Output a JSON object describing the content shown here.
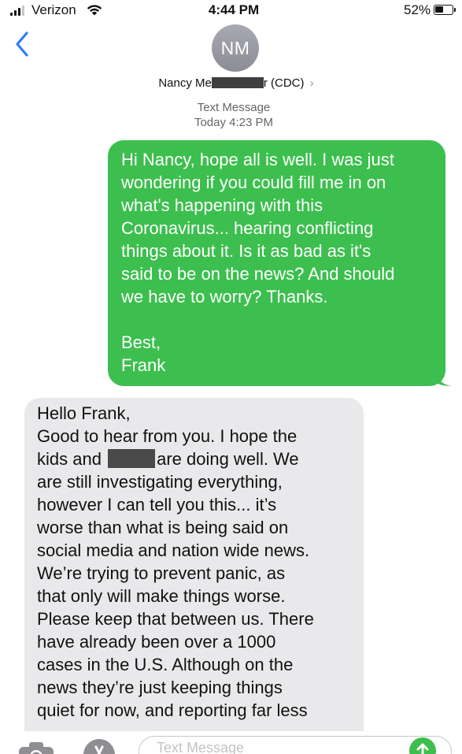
{
  "status_bar": {
    "carrier": "Verizon",
    "time": "4:44 PM",
    "battery_percent": "52%",
    "battery_level": 0.52,
    "icons": [
      "signal-icon",
      "wifi-icon",
      "battery-icon"
    ]
  },
  "header": {
    "avatar_initials": "NM",
    "contact_name_before": "Nancy Me",
    "contact_name_after": "r (CDC)",
    "chevron": "›",
    "service_label": "Text Message",
    "timestamp": "Today 4:23 PM"
  },
  "conversation": {
    "sent": {
      "lines": [
        "Hi Nancy, hope all is well. I was just",
        "wondering if you could fill me in on",
        "what's happening with this",
        "Coronavirus... hearing conflicting",
        "things about it. Is it as bad as it's",
        "said to be on the news? And should",
        "we have to worry? Thanks."
      ],
      "closing": "Best,",
      "signature": "Frank"
    },
    "received": {
      "line1": "Hello Frank,",
      "line2": "Good to hear from you. I hope the",
      "line3_before": "kids and",
      "line3_after": "are doing well. We",
      "lines_rest": [
        "are still investigating everything,",
        "however I can tell you this... it’s",
        "worse than what is being said on",
        "social media and nation wide news.",
        "We’re trying to prevent panic, as",
        "that only will make things worse.",
        "Please keep that between us. There",
        "have already been over a 1000",
        "cases in the U.S. Although on the",
        "news they’re just keeping things",
        "quiet for now, and reporting far less"
      ]
    }
  },
  "input_bar": {
    "placeholder": "Text Message",
    "icons": [
      "camera-icon",
      "app-store-icon",
      "send-arrow-icon"
    ],
    "accent_color": "#3cbf4e"
  },
  "colors": {
    "sent_bubble": "#3cbf4e",
    "received_bubble": "#e9e9eb",
    "link_blue": "#2f7cf6"
  }
}
